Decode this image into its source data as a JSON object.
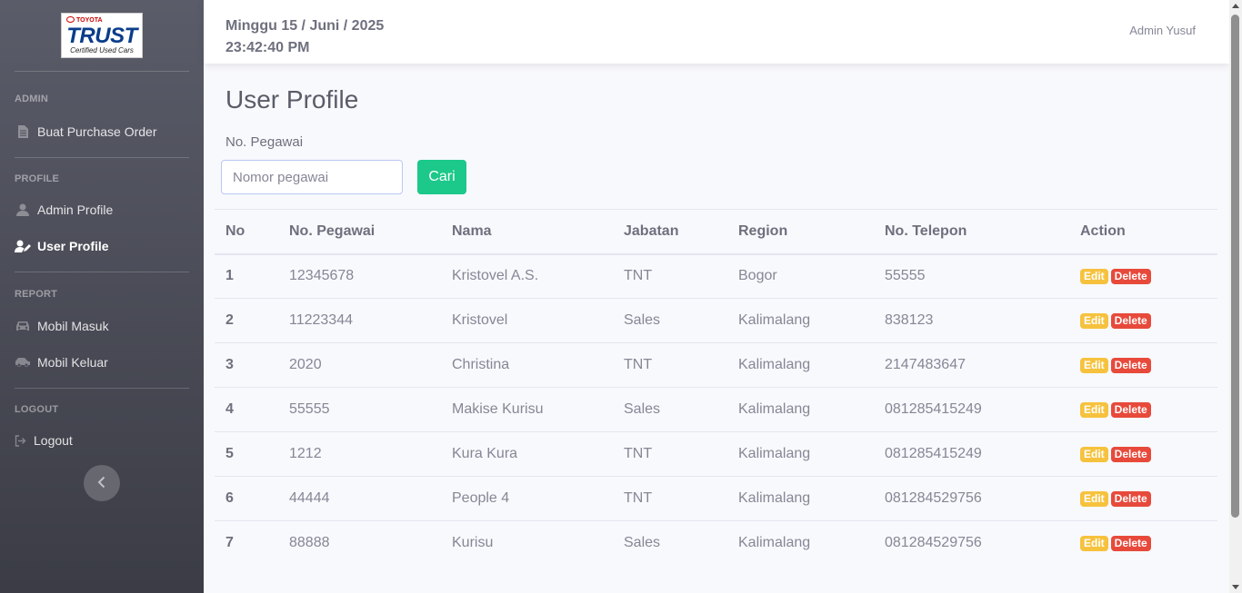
{
  "brand": {
    "logo_top": "TOYOTA",
    "logo_main": "TRUST",
    "logo_sub": "Certified Used Cars"
  },
  "sidebar": {
    "sections": [
      {
        "heading": "ADMIN",
        "items": [
          {
            "label": "Buat Purchase Order",
            "icon": "file-icon",
            "active": false
          }
        ]
      },
      {
        "heading": "PROFILE",
        "items": [
          {
            "label": "Admin Profile",
            "icon": "user-icon",
            "active": false
          },
          {
            "label": "User Profile",
            "icon": "user-edit-icon",
            "active": true
          }
        ]
      },
      {
        "heading": "REPORT",
        "items": [
          {
            "label": "Mobil Masuk",
            "icon": "car-icon",
            "active": false
          },
          {
            "label": "Mobil Keluar",
            "icon": "car-side-icon",
            "active": false
          }
        ]
      },
      {
        "heading": "LOGOUT",
        "items": [
          {
            "label": "Logout",
            "icon": "sign-out-icon",
            "active": false
          }
        ]
      }
    ],
    "toggle_icon": "chevron-left-icon"
  },
  "topbar": {
    "date": "Minggu 15 / Juni / 2025",
    "time": "23:42:40 PM",
    "user": "Admin Yusuf"
  },
  "main": {
    "title": "User Profile",
    "search": {
      "label": "No. Pegawai",
      "placeholder": "Nomor pegawai",
      "value": "",
      "button": "Cari"
    },
    "table": {
      "columns": [
        "No",
        "No. Pegawai",
        "Nama",
        "Jabatan",
        "Region",
        "No. Telepon",
        "Action"
      ],
      "rows": [
        [
          "1",
          "12345678",
          "Kristovel A.S.",
          "TNT",
          "Bogor",
          "55555"
        ],
        [
          "2",
          "11223344",
          "Kristovel",
          "Sales",
          "Kalimalang",
          "838123"
        ],
        [
          "3",
          "2020",
          "Christina",
          "TNT",
          "Kalimalang",
          "2147483647"
        ],
        [
          "4",
          "55555",
          "Makise Kurisu",
          "Sales",
          "Kalimalang",
          "081285415249"
        ],
        [
          "5",
          "1212",
          "Kura Kura",
          "TNT",
          "Kalimalang",
          "081285415249"
        ],
        [
          "6",
          "44444",
          "People 4",
          "TNT",
          "Kalimalang",
          "081284529756"
        ],
        [
          "7",
          "88888",
          "Kurisu",
          "Sales",
          "Kalimalang",
          "081284529756"
        ]
      ],
      "action_labels": {
        "edit": "Edit",
        "delete": "Delete"
      }
    }
  },
  "colors": {
    "sidebar": "#5a5c69",
    "success": "#1cc88a",
    "warning": "#f6c23e",
    "danger": "#e74a3b"
  }
}
